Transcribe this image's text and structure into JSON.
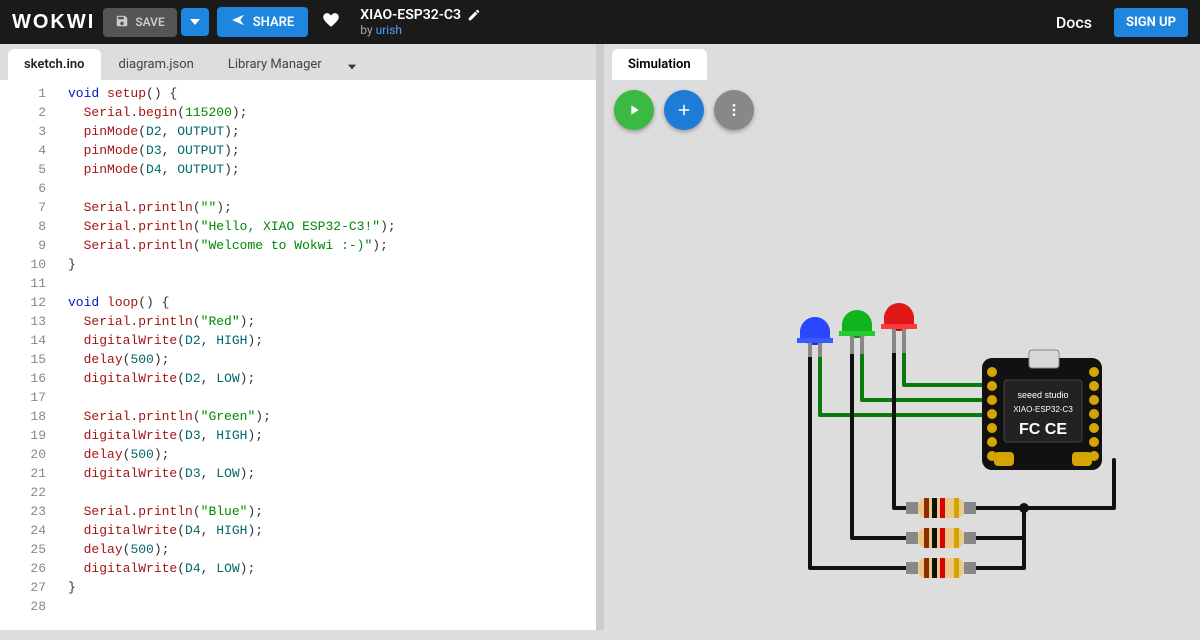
{
  "header": {
    "logo": "WOKWI",
    "save": "SAVE",
    "share": "SHARE",
    "projectName": "XIAO-ESP32-C3",
    "byPrefix": "by ",
    "author": "urish",
    "docs": "Docs",
    "signup": "SIGN UP"
  },
  "editorTabs": {
    "t0": "sketch.ino",
    "t1": "diagram.json",
    "t2": "Library Manager"
  },
  "simTab": "Simulation",
  "lineNumbers": [
    "1",
    "2",
    "3",
    "4",
    "5",
    "6",
    "7",
    "8",
    "9",
    "10",
    "11",
    "12",
    "13",
    "14",
    "15",
    "16",
    "17",
    "18",
    "19",
    "20",
    "21",
    "22",
    "23",
    "24",
    "25",
    "26",
    "27",
    "28"
  ],
  "code": {
    "l1": {
      "kw": "void",
      "fn": "setup"
    },
    "l2": {
      "obj": "Serial",
      "m": "begin",
      "arg": "115200"
    },
    "l3": {
      "fn": "pinMode",
      "a": "D2",
      "b": "OUTPUT"
    },
    "l4": {
      "fn": "pinMode",
      "a": "D3",
      "b": "OUTPUT"
    },
    "l5": {
      "fn": "pinMode",
      "a": "D4",
      "b": "OUTPUT"
    },
    "l7": {
      "obj": "Serial",
      "m": "println",
      "s": "\"\""
    },
    "l8": {
      "obj": "Serial",
      "m": "println",
      "s": "\"Hello, XIAO ESP32-C3!\""
    },
    "l9": {
      "obj": "Serial",
      "m": "println",
      "s": "\"Welcome to Wokwi :-)\""
    },
    "l12": {
      "kw": "void",
      "fn": "loop"
    },
    "l13": {
      "obj": "Serial",
      "m": "println",
      "s": "\"Red\""
    },
    "l14": {
      "fn": "digitalWrite",
      "a": "D2",
      "b": "HIGH"
    },
    "l15": {
      "fn": "delay",
      "arg": "500"
    },
    "l16": {
      "fn": "digitalWrite",
      "a": "D2",
      "b": "LOW"
    },
    "l18": {
      "obj": "Serial",
      "m": "println",
      "s": "\"Green\""
    },
    "l19": {
      "fn": "digitalWrite",
      "a": "D3",
      "b": "HIGH"
    },
    "l20": {
      "fn": "delay",
      "arg": "500"
    },
    "l21": {
      "fn": "digitalWrite",
      "a": "D3",
      "b": "LOW"
    },
    "l23": {
      "obj": "Serial",
      "m": "println",
      "s": "\"Blue\""
    },
    "l24": {
      "fn": "digitalWrite",
      "a": "D4",
      "b": "HIGH"
    },
    "l25": {
      "fn": "delay",
      "arg": "500"
    },
    "l26": {
      "fn": "digitalWrite",
      "a": "D4",
      "b": "LOW"
    }
  },
  "board": {
    "brand": "seeed studio",
    "model": "XIAO-ESP32-C3"
  }
}
